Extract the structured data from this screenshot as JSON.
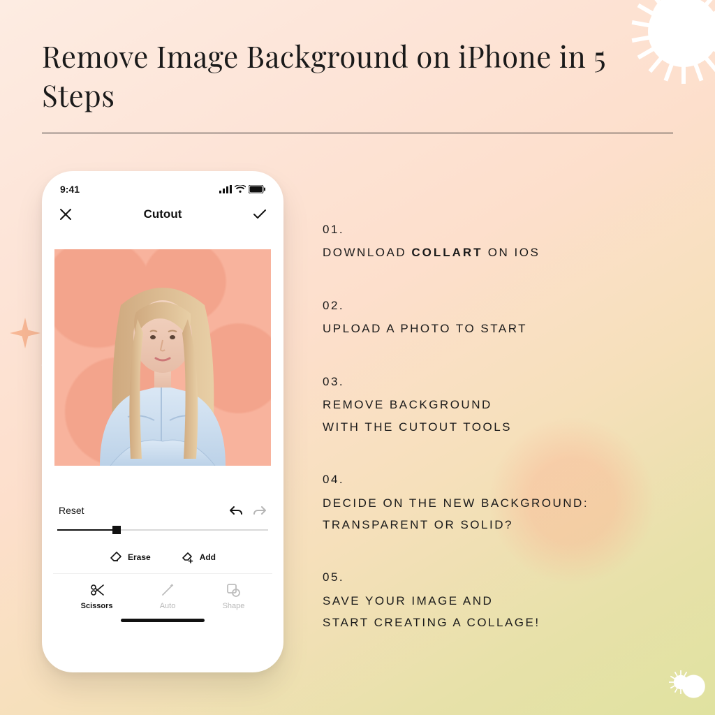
{
  "title": "Remove Image Background on iPhone in 5 Steps",
  "phone": {
    "status": {
      "time": "9:41"
    },
    "nav": {
      "title": "Cutout"
    },
    "reset_label": "Reset",
    "tools": {
      "erase": "Erase",
      "add": "Add"
    },
    "tabs": {
      "scissors": "Scissors",
      "auto": "Auto",
      "shape": "Shape"
    }
  },
  "steps": [
    {
      "num": "01.",
      "pre": "DOWNLOAD ",
      "bold": "COLLART",
      "post": " ON IOS"
    },
    {
      "num": "02.",
      "text": "UPLOAD A PHOTO TO START"
    },
    {
      "num": "03.",
      "text": "REMOVE BACKGROUND\nWITH THE CUTOUT TOOLS"
    },
    {
      "num": "04.",
      "text": "DECIDE ON THE NEW BACKGROUND:\nTRANSPARENT OR SOLID?"
    },
    {
      "num": "05.",
      "text": "SAVE YOUR IMAGE AND\nSTART CREATING A COLLAGE!"
    }
  ]
}
